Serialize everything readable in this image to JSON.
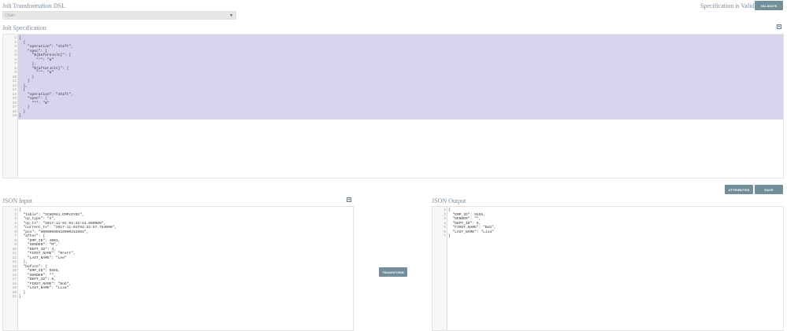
{
  "header": {
    "title": "Jolt Transformation DSL",
    "status": "Specification is Valid",
    "validate_label": "VALIDATE"
  },
  "dsl_select": {
    "value": "Chain"
  },
  "spec": {
    "title": "Jolt Specification",
    "line_numbers": "1\n2\n3\n4\n5\n6\n7\n8\n9\n10\n11\n12\n13\n14\n15\n16\n17\n18\n19",
    "code": "[\n  {\n    \"operation\": \"shift\",\n    \"spec\": {\n      \"${beforeJolt}\": {\n        \"*\": \"&\"\n      },\n      \"${afterJolt}\": {\n        \"*\": \"&\"\n      }\n    }\n  },\n  {\n    \"operation\": \"shift\",\n    \"spec\": {\n      \"*\": \"&\"\n    }\n  }\n]"
  },
  "buttons": {
    "attributes_label": "ATTRIBUTES",
    "save_label": "SAVE",
    "transform_label": "TRANSFORM"
  },
  "input": {
    "title": "JSON Input",
    "line_numbers": "1\n2\n3\n4\n5\n6\n7\n8\n9\n10\n11\n12\n13\n14\n15\n16\n17\n18\n19\n20\n21",
    "code": "{\n  \"table\": \"SCHEMA1.EMPLOYEE\",\n  \"op_type\": \"I\",\n  \"op_ts\": \"2017-11-01 04:32:54.000000\",\n  \"current_ts\": \"2017-11-01T04:32:57.754000\",\n  \"pos\": \"00000000410000312864\",\n  \"after\": {\n    \"EMP_ID\": 4001,\n    \"GENDER\": \"M\",\n    \"DEPT_ID\": 4,\n    \"FIRST_NAME\": \"Brett\",\n    \"LAST_NAME\": \"Lee\"\n  },\n  \"before\": {\n    \"EMP_ID\": 5555,\n    \"GENDER\": \"\",\n    \"DEPT_ID\": 5,\n    \"FIRST_NAME\": \"Bob\",\n    \"LAST_NAME\": \"Lisa\"\n  }\n}"
  },
  "output": {
    "title": "JSON Output",
    "line_numbers": "1\n2\n3\n4\n5\n6\n7",
    "code": "{\n  \"EMP_ID\": 5555,\n  \"GENDER\": \"\",\n  \"DEPT_ID\": 5,\n  \"FIRST_NAME\": \"Bob\",\n  \"LAST_NAME\": \"Lisa\"\n}"
  },
  "colors": {
    "button": "#728e9b",
    "title": "#7a8b99",
    "selection": "#d7d4f0"
  }
}
